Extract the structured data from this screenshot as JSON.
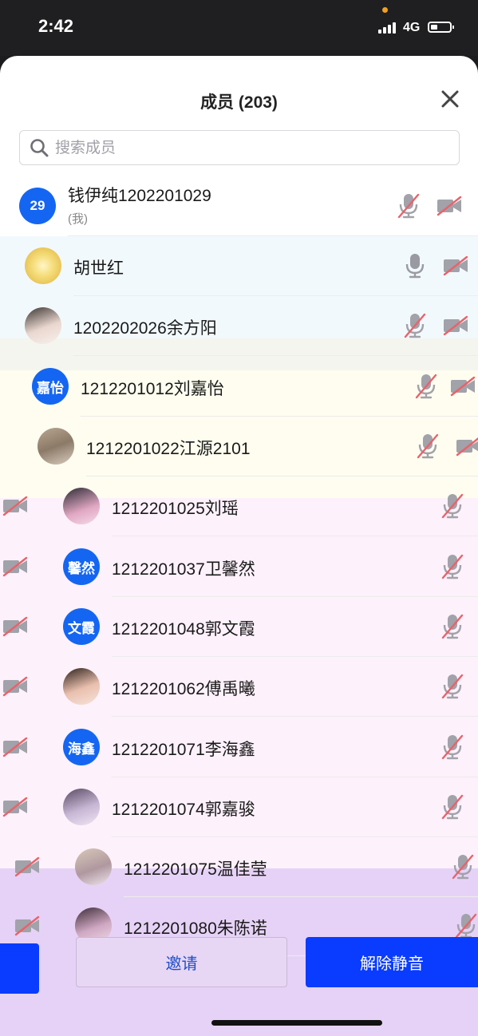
{
  "status_bar": {
    "time": "2:42",
    "network": "4G"
  },
  "panel": {
    "title": "成员 (203)",
    "search_placeholder": "搜索成员"
  },
  "members": [
    {
      "avatar_text": "29",
      "name": "钱伊纯1202201029",
      "sub": "(我)",
      "mic": "muted",
      "cam": "off"
    },
    {
      "avatar_text": "",
      "name": "胡世红",
      "mic": "on",
      "cam": "off"
    },
    {
      "avatar_text": "",
      "name": "1202202026余方阳",
      "mic": "muted",
      "cam": "off"
    },
    {
      "avatar_text": "嘉怡",
      "name": "1212201012刘嘉怡",
      "mic": "muted",
      "cam": "off"
    },
    {
      "avatar_text": "",
      "name": "1212201022江源2101",
      "mic": "muted",
      "cam": "off"
    },
    {
      "avatar_text": "",
      "name": "1212201025刘瑶",
      "mic": "muted",
      "cam": "off"
    },
    {
      "avatar_text": "馨然",
      "name": "1212201037卫馨然",
      "mic": "muted",
      "cam": "off"
    },
    {
      "avatar_text": "文霞",
      "name": "1212201048郭文霞",
      "mic": "muted",
      "cam": "off"
    },
    {
      "avatar_text": "",
      "name": "1212201062傅禹曦",
      "mic": "muted",
      "cam": "off"
    },
    {
      "avatar_text": "海鑫",
      "name": "1212201071李海鑫",
      "mic": "muted",
      "cam": "off"
    },
    {
      "avatar_text": "",
      "name": "1212201074郭嘉骏",
      "mic": "muted",
      "cam": "off"
    },
    {
      "avatar_text": "",
      "name": "1212201075温佳莹",
      "mic": "muted",
      "cam": "off"
    },
    {
      "avatar_text": "",
      "name": "1212201080朱陈诺",
      "mic": "muted",
      "cam": "off"
    }
  ],
  "actions": {
    "invite": "邀请",
    "unmute": "解除静音"
  },
  "colors": {
    "accent": "#0a3cff",
    "avatar_blue": "#1466f2",
    "muted_icon": "#e8636b"
  }
}
